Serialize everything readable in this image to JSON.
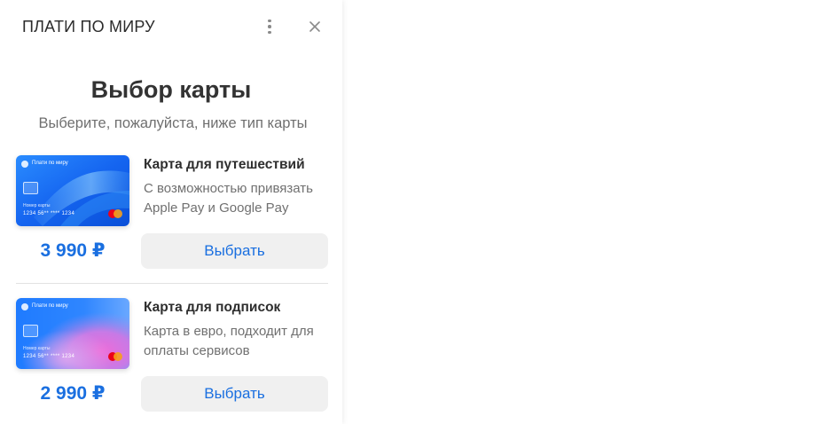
{
  "header": {
    "title": "ПЛАТИ ПО МИРУ"
  },
  "main": {
    "heading": "Выбор карты",
    "subheading": "Выберите, пожалуйста, ниже тип карты"
  },
  "offers": [
    {
      "title": "Карта для путешествий",
      "desc": "С возможностью привязать Apple Pay и Google Pay",
      "price": "3 990 ₽",
      "button_label": "Выбрать",
      "card": {
        "brand": "Плати по миру",
        "number_label": "Номер карты",
        "number": "1234  56**  ****  1234",
        "style": "blue-wave"
      }
    },
    {
      "title": "Карта для подписок",
      "desc": "Карта в евро, подходит для оплаты сервисов",
      "price": "2 990 ₽",
      "button_label": "Выбрать",
      "card": {
        "brand": "Плати по миру",
        "number_label": "Номер карты",
        "number": "1234  56**  ****  1234",
        "style": "blue-pink"
      }
    }
  ],
  "colors": {
    "accent": "#1a6fe0",
    "heading": "#333333",
    "muted": "#707070",
    "button_bg": "#f0f0f0"
  },
  "icons": {
    "menu": "vertical-dots-icon",
    "close": "close-icon",
    "card_payment_system": "mastercard-icon"
  }
}
